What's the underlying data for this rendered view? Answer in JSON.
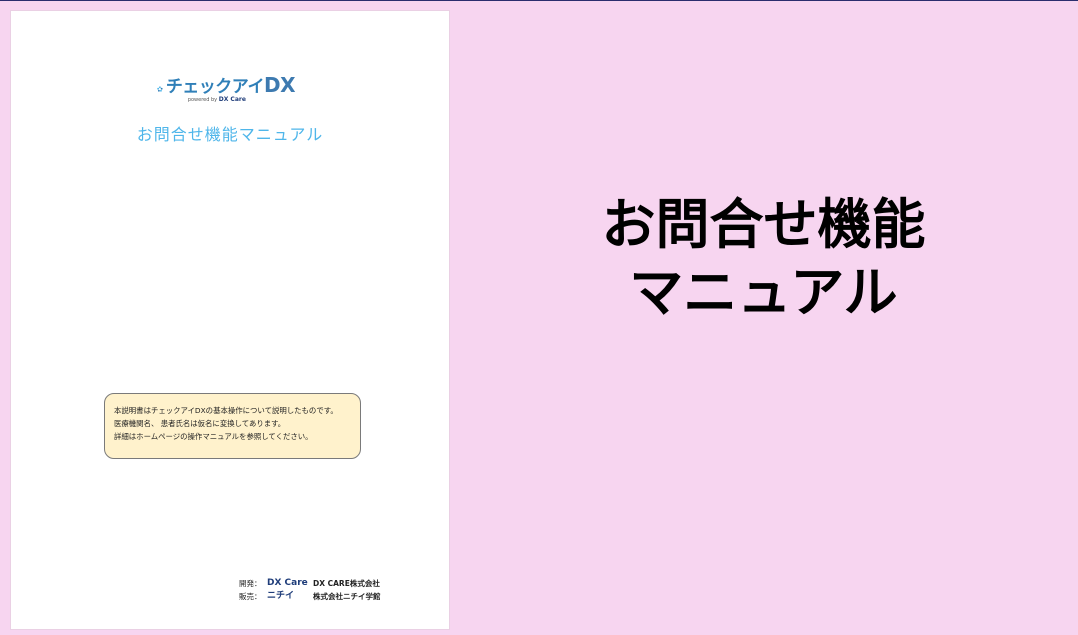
{
  "cover": {
    "logo": {
      "brand": "チェックアイ",
      "brand_suffix": "DX",
      "powered_by": "powered by",
      "powered_brand": "DX Care"
    },
    "subtitle": "お問合せ機能マニュアル",
    "notice_lines": [
      "本説明書はチェックアイDXの基本操作について説明したものです。",
      "医療機関名、 患者氏名は仮名に変換してあります。",
      "詳細はホームページの操作マニュアルを参照してください。"
    ],
    "credits": [
      {
        "label": "開発：",
        "logo": "DX Care",
        "company": "DX CARE株式会社"
      },
      {
        "label": "販売：",
        "logo": "ニチイ",
        "company": "株式会社ニチイ学館"
      }
    ]
  },
  "title_lines": [
    "お問合せ機能",
    "マニュアル"
  ],
  "colors": {
    "background": "#f7d5f0",
    "accent": "#4fb6ea",
    "notice_bg": "#fff2cc"
  }
}
